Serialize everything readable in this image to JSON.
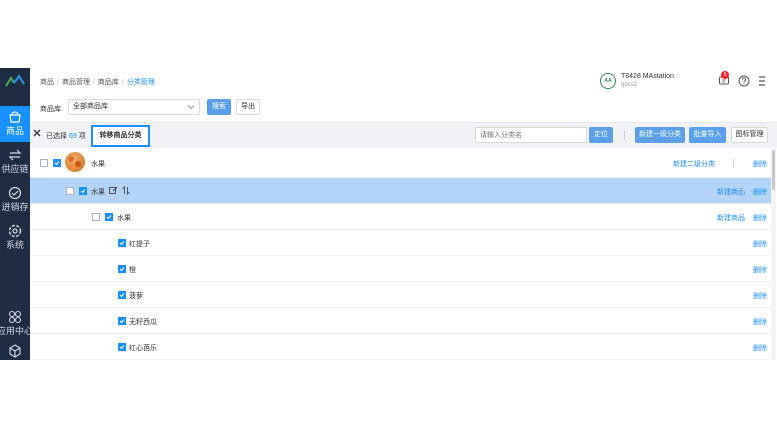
{
  "sidebar": {
    "items": [
      {
        "label": "商品",
        "icon": "basket-icon",
        "active": true
      },
      {
        "label": "供应链",
        "icon": "exchange-icon",
        "active": false
      },
      {
        "label": "进销存",
        "icon": "inventory-icon",
        "active": false
      },
      {
        "label": "系统",
        "icon": "gear-icon",
        "active": false
      },
      {
        "label": "应用中心",
        "icon": "apps-icon",
        "active": false
      },
      {
        "label": "",
        "icon": "cube-icon",
        "active": false
      }
    ]
  },
  "breadcrumb": [
    "商品",
    "商品管理",
    "商品库",
    "分类管理"
  ],
  "store": {
    "logo_text": "AA",
    "name": "T8428 MAstation",
    "sub": "qocs2"
  },
  "notifications": {
    "count": "5"
  },
  "filter": {
    "label": "商品库",
    "select_value": "全部商品库",
    "search_button": "搜索",
    "export_button": "导出"
  },
  "toolbar": {
    "selected_prefix": "已选择",
    "selected_count": "69",
    "selected_suffix": "项",
    "move_button": "转移商品分类",
    "search_placeholder": "请输入分类名",
    "locate_button": "定位",
    "new_category_button": "新建一级分类",
    "batch_import_button": "批量导入",
    "icon_manage_button": "图标管理"
  },
  "rows": [
    {
      "label": "水果",
      "actions": [
        "新建二级分类",
        "删除"
      ]
    },
    {
      "label": "水果",
      "actions": [
        "新建商品",
        "删除"
      ]
    },
    {
      "label": "水果",
      "actions": [
        "新建商品",
        "删除"
      ]
    },
    {
      "label": "红提子",
      "actions": [
        "删除"
      ]
    },
    {
      "label": "橙",
      "actions": [
        "删除"
      ]
    },
    {
      "label": "菠萝",
      "actions": [
        "删除"
      ]
    },
    {
      "label": "无籽西瓜",
      "actions": [
        "删除"
      ]
    },
    {
      "label": "红心芭乐",
      "actions": [
        "删除"
      ]
    }
  ],
  "colors": {
    "primary": "#1890ff",
    "sidebar": "#1f2d44",
    "highlight_row": "#b3d4fb"
  }
}
